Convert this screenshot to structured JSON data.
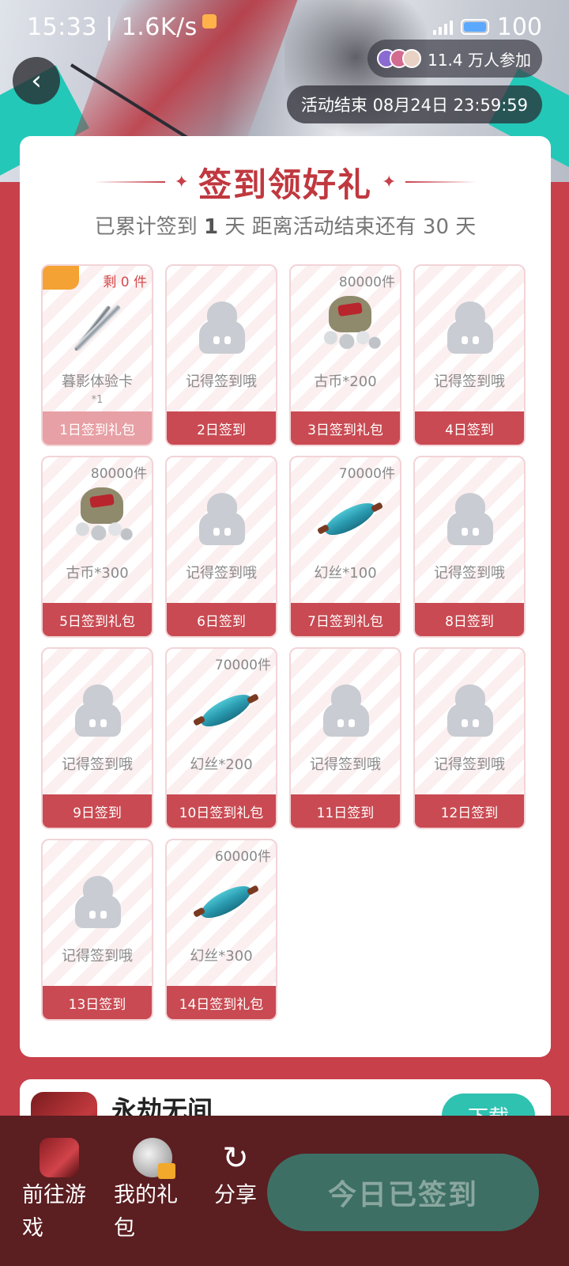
{
  "status_bar": {
    "time": "15:33",
    "speed": "1.6K/s",
    "battery": "100"
  },
  "header": {
    "participants": "11.4 万人参加",
    "end_time": "活动结束 08月24日 23:59:59"
  },
  "checkin": {
    "title": "签到领好礼",
    "sub_prefix": "已累计签到",
    "sub_days": "1",
    "sub_suffix": "天  距离活动结束还有 30 天"
  },
  "tiles": [
    {
      "day": "1日签到礼包",
      "name": "暮影体验卡",
      "sub": "*1",
      "stock": "剩 0 件",
      "art": "sword-icon",
      "done": true
    },
    {
      "day": "2日签到",
      "name": "记得签到哦",
      "stock": "",
      "art": "placeholder-icon"
    },
    {
      "day": "3日签到礼包",
      "name": "古币*200",
      "stock": "80000件",
      "art": "coin-bag-icon"
    },
    {
      "day": "4日签到",
      "name": "记得签到哦",
      "stock": "",
      "art": "placeholder-icon"
    },
    {
      "day": "5日签到礼包",
      "name": "古币*300",
      "stock": "80000件",
      "art": "coin-bag-icon"
    },
    {
      "day": "6日签到",
      "name": "记得签到哦",
      "stock": "",
      "art": "placeholder-icon"
    },
    {
      "day": "7日签到礼包",
      "name": "幻丝*100",
      "stock": "70000件",
      "art": "silk-spool-icon"
    },
    {
      "day": "8日签到",
      "name": "记得签到哦",
      "stock": "",
      "art": "placeholder-icon"
    },
    {
      "day": "9日签到",
      "name": "记得签到哦",
      "stock": "",
      "art": "placeholder-icon"
    },
    {
      "day": "10日签到礼包",
      "name": "幻丝*200",
      "stock": "70000件",
      "art": "silk-spool-icon"
    },
    {
      "day": "11日签到",
      "name": "记得签到哦",
      "stock": "",
      "art": "placeholder-icon"
    },
    {
      "day": "12日签到",
      "name": "记得签到哦",
      "stock": "",
      "art": "placeholder-icon"
    },
    {
      "day": "13日签到",
      "name": "记得签到哦",
      "stock": "",
      "art": "placeholder-icon"
    },
    {
      "day": "14日签到礼包",
      "name": "幻丝*300",
      "stock": "60000件",
      "art": "silk-spool-icon"
    }
  ],
  "game_card": {
    "name": "永劫无间",
    "download_label": "下载"
  },
  "bottom_bar": {
    "go_game": "前往游戏",
    "my_gifts": "我的礼包",
    "share": "分享",
    "signed_today": "今日已签到"
  }
}
